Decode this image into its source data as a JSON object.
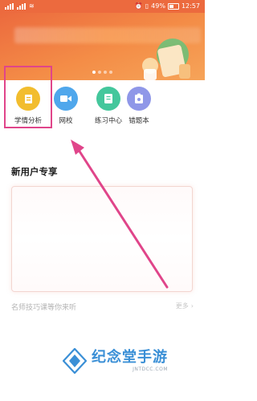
{
  "status_bar": {
    "battery": "49%",
    "time": "12:57"
  },
  "banner": {
    "slide_count": 4,
    "active_slide": 1
  },
  "quick_menu": {
    "items": [
      {
        "label": "学情分析",
        "icon": "study-analysis-icon",
        "color": "#f2bd2e"
      },
      {
        "label": "网校",
        "icon": "video-camera-icon",
        "color": "#4fa7ec"
      },
      {
        "label": "练习中心",
        "icon": "practice-book-icon",
        "color": "#44c79c"
      },
      {
        "label": "错题本",
        "icon": "mistake-book-icon",
        "color": "#8f97e8"
      }
    ]
  },
  "new_user": {
    "title": "新用户专享"
  },
  "teacher": {
    "text": "名师技巧课等你来听",
    "more": "更多"
  },
  "watermark": {
    "text": "纪念堂手游",
    "sub": "JNTDCC.COM"
  },
  "colors": {
    "brand_orange": "#ec6a3e",
    "annotation_pink": "#e0458a",
    "watermark_blue": "#3a8fd6"
  }
}
